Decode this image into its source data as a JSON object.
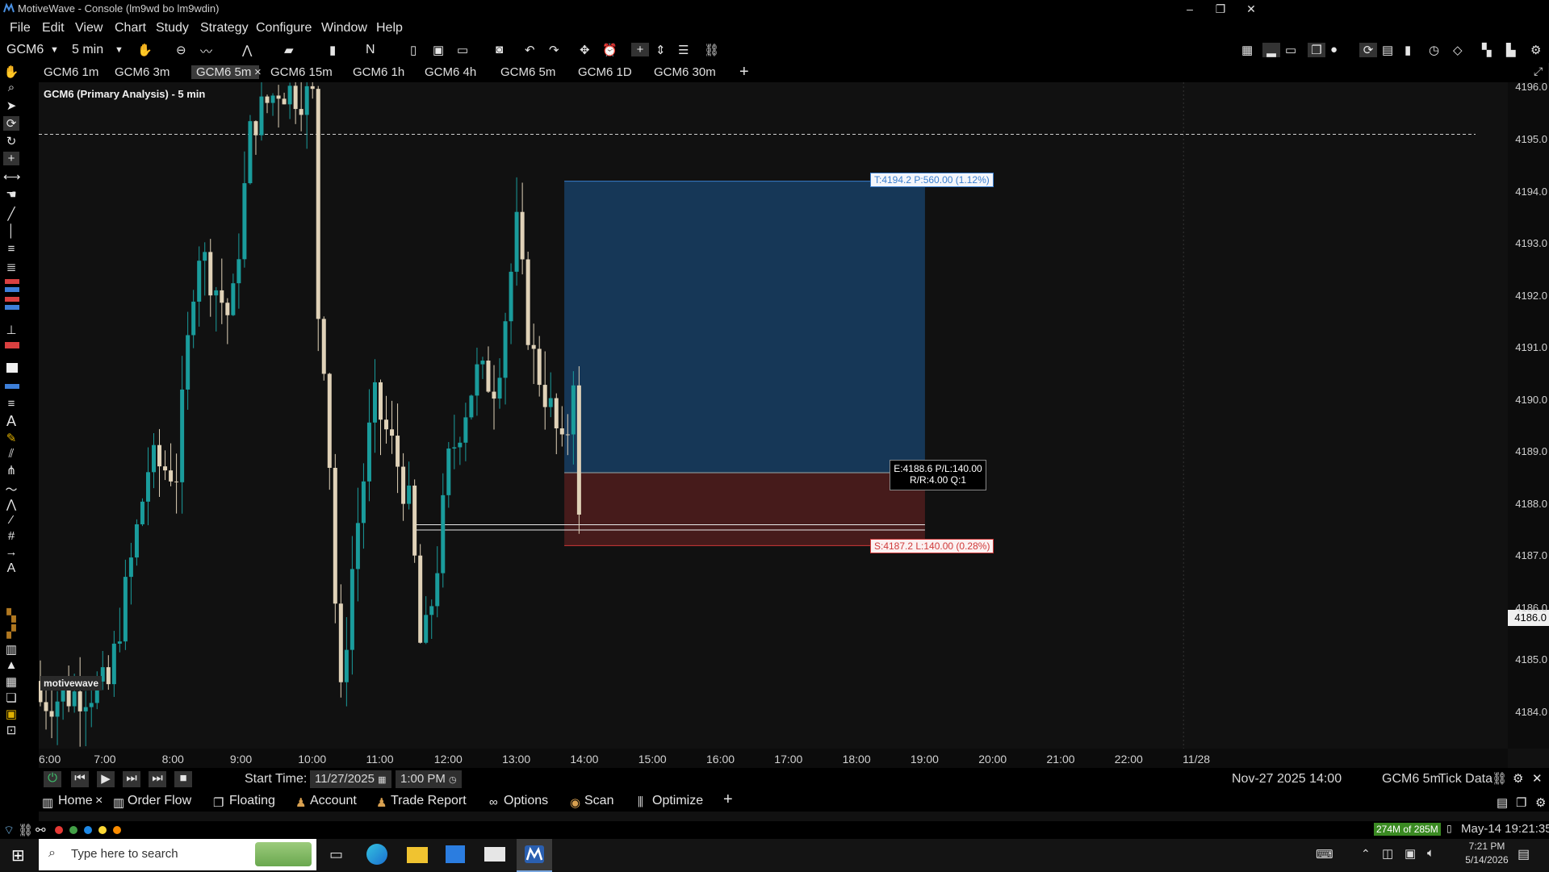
{
  "window": {
    "title": "MotiveWave - Console (lm9wd bo lm9wdin)",
    "minimize": "–",
    "restore": "❐",
    "close": "✕"
  },
  "menu": [
    "File",
    "Edit",
    "View",
    "Chart",
    "Study",
    "Strategy",
    "Configure",
    "Window",
    "Help"
  ],
  "toolbar": {
    "symbol": "GCM6",
    "bar_size": "5 min",
    "indicator_N": "N"
  },
  "tabs": [
    {
      "label": "GCM6 1m",
      "active": false
    },
    {
      "label": "GCM6 3m",
      "active": false
    },
    {
      "label": "GCM6 5m",
      "active": true,
      "close": "×"
    },
    {
      "label": "GCM6 15m",
      "active": false
    },
    {
      "label": "GCM6 1h",
      "active": false
    },
    {
      "label": "GCM6 4h",
      "active": false
    },
    {
      "label": "GCM6 5m",
      "active": false
    },
    {
      "label": "GCM6 1D",
      "active": false
    },
    {
      "label": "GCM6 30m",
      "active": false
    }
  ],
  "tab_add": "+",
  "chart": {
    "title": "GCM6 (Primary Analysis) - 5 min",
    "watermark": "motivewave",
    "current_price": "4186.0",
    "target_label": "T:4194.2 P:560.00 (1.12%)",
    "entry_label_line1": "E:4188.6 P/L:140.00",
    "entry_label_line2": "R/R:4.00 Q:1",
    "stop_label": "S:4187.2 L:140.00 (0.28%)"
  },
  "chart_data": {
    "type": "candlestick",
    "symbol": "GCM6",
    "interval": "5 min",
    "x_axis_ticks": [
      "6:00",
      "7:00",
      "8:00",
      "9:00",
      "10:00",
      "11:00",
      "12:00",
      "13:00",
      "14:00",
      "15:00",
      "16:00",
      "17:00",
      "18:00",
      "19:00",
      "20:00",
      "21:00",
      "22:00",
      "11/28"
    ],
    "y_axis_ticks": [
      "4196.0",
      "4195.0",
      "4194.0",
      "4193.0",
      "4192.0",
      "4191.0",
      "4190.0",
      "4189.0",
      "4188.0",
      "4187.0",
      "4186.0",
      "4185.0",
      "4184.0"
    ],
    "ylim": [
      4183.3,
      4196.1
    ],
    "position": {
      "entry": 4188.6,
      "target": 4194.2,
      "stop": 4187.2,
      "rr": 4.0,
      "qty": 1
    },
    "dashed_line": 4195.1,
    "colors": {
      "up": "#1a9c9c",
      "down": "#e0d2b8",
      "target_zone": "#173a5c",
      "stop_zone": "#4a1c1c"
    }
  },
  "bottom": {
    "start_time_label": "Start Time:",
    "start_date": "11/27/2025",
    "start_time": "1:00 PM",
    "datetime_info": "Nov-27 2025 14:00",
    "series_info": "GCM6 5m",
    "data_info": "Tick Data"
  },
  "bottom_tabs": [
    {
      "label": "Home",
      "close": "×"
    },
    {
      "label": "Order Flow"
    },
    {
      "label": "Floating"
    },
    {
      "label": "Account"
    },
    {
      "label": "Trade Report"
    },
    {
      "label": "Options"
    },
    {
      "label": "Scan"
    },
    {
      "label": "Optimize"
    }
  ],
  "bottom_add": "+",
  "status": {
    "memory": "274M of 285M",
    "clock": "May-14 19:21:35",
    "dot_colors": [
      "#e53935",
      "#43a047",
      "#1e88e5",
      "#fdd835",
      "#fb8c00"
    ]
  },
  "taskbar": {
    "search_placeholder": "Type here to search",
    "time": "7:21 PM",
    "date": "5/14/2026"
  }
}
